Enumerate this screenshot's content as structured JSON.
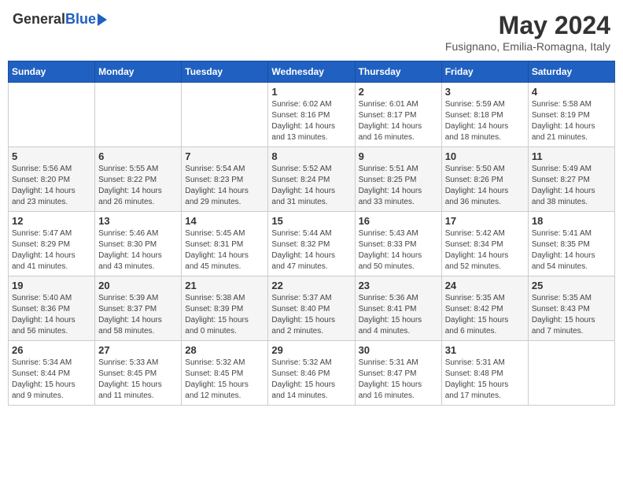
{
  "header": {
    "logo_general": "General",
    "logo_blue": "Blue",
    "month_title": "May 2024",
    "location": "Fusignano, Emilia-Romagna, Italy"
  },
  "weekdays": [
    "Sunday",
    "Monday",
    "Tuesday",
    "Wednesday",
    "Thursday",
    "Friday",
    "Saturday"
  ],
  "weeks": [
    [
      {
        "day": "",
        "info": ""
      },
      {
        "day": "",
        "info": ""
      },
      {
        "day": "",
        "info": ""
      },
      {
        "day": "1",
        "info": "Sunrise: 6:02 AM\nSunset: 8:16 PM\nDaylight: 14 hours\nand 13 minutes."
      },
      {
        "day": "2",
        "info": "Sunrise: 6:01 AM\nSunset: 8:17 PM\nDaylight: 14 hours\nand 16 minutes."
      },
      {
        "day": "3",
        "info": "Sunrise: 5:59 AM\nSunset: 8:18 PM\nDaylight: 14 hours\nand 18 minutes."
      },
      {
        "day": "4",
        "info": "Sunrise: 5:58 AM\nSunset: 8:19 PM\nDaylight: 14 hours\nand 21 minutes."
      }
    ],
    [
      {
        "day": "5",
        "info": "Sunrise: 5:56 AM\nSunset: 8:20 PM\nDaylight: 14 hours\nand 23 minutes."
      },
      {
        "day": "6",
        "info": "Sunrise: 5:55 AM\nSunset: 8:22 PM\nDaylight: 14 hours\nand 26 minutes."
      },
      {
        "day": "7",
        "info": "Sunrise: 5:54 AM\nSunset: 8:23 PM\nDaylight: 14 hours\nand 29 minutes."
      },
      {
        "day": "8",
        "info": "Sunrise: 5:52 AM\nSunset: 8:24 PM\nDaylight: 14 hours\nand 31 minutes."
      },
      {
        "day": "9",
        "info": "Sunrise: 5:51 AM\nSunset: 8:25 PM\nDaylight: 14 hours\nand 33 minutes."
      },
      {
        "day": "10",
        "info": "Sunrise: 5:50 AM\nSunset: 8:26 PM\nDaylight: 14 hours\nand 36 minutes."
      },
      {
        "day": "11",
        "info": "Sunrise: 5:49 AM\nSunset: 8:27 PM\nDaylight: 14 hours\nand 38 minutes."
      }
    ],
    [
      {
        "day": "12",
        "info": "Sunrise: 5:47 AM\nSunset: 8:29 PM\nDaylight: 14 hours\nand 41 minutes."
      },
      {
        "day": "13",
        "info": "Sunrise: 5:46 AM\nSunset: 8:30 PM\nDaylight: 14 hours\nand 43 minutes."
      },
      {
        "day": "14",
        "info": "Sunrise: 5:45 AM\nSunset: 8:31 PM\nDaylight: 14 hours\nand 45 minutes."
      },
      {
        "day": "15",
        "info": "Sunrise: 5:44 AM\nSunset: 8:32 PM\nDaylight: 14 hours\nand 47 minutes."
      },
      {
        "day": "16",
        "info": "Sunrise: 5:43 AM\nSunset: 8:33 PM\nDaylight: 14 hours\nand 50 minutes."
      },
      {
        "day": "17",
        "info": "Sunrise: 5:42 AM\nSunset: 8:34 PM\nDaylight: 14 hours\nand 52 minutes."
      },
      {
        "day": "18",
        "info": "Sunrise: 5:41 AM\nSunset: 8:35 PM\nDaylight: 14 hours\nand 54 minutes."
      }
    ],
    [
      {
        "day": "19",
        "info": "Sunrise: 5:40 AM\nSunset: 8:36 PM\nDaylight: 14 hours\nand 56 minutes."
      },
      {
        "day": "20",
        "info": "Sunrise: 5:39 AM\nSunset: 8:37 PM\nDaylight: 14 hours\nand 58 minutes."
      },
      {
        "day": "21",
        "info": "Sunrise: 5:38 AM\nSunset: 8:39 PM\nDaylight: 15 hours\nand 0 minutes."
      },
      {
        "day": "22",
        "info": "Sunrise: 5:37 AM\nSunset: 8:40 PM\nDaylight: 15 hours\nand 2 minutes."
      },
      {
        "day": "23",
        "info": "Sunrise: 5:36 AM\nSunset: 8:41 PM\nDaylight: 15 hours\nand 4 minutes."
      },
      {
        "day": "24",
        "info": "Sunrise: 5:35 AM\nSunset: 8:42 PM\nDaylight: 15 hours\nand 6 minutes."
      },
      {
        "day": "25",
        "info": "Sunrise: 5:35 AM\nSunset: 8:43 PM\nDaylight: 15 hours\nand 7 minutes."
      }
    ],
    [
      {
        "day": "26",
        "info": "Sunrise: 5:34 AM\nSunset: 8:44 PM\nDaylight: 15 hours\nand 9 minutes."
      },
      {
        "day": "27",
        "info": "Sunrise: 5:33 AM\nSunset: 8:45 PM\nDaylight: 15 hours\nand 11 minutes."
      },
      {
        "day": "28",
        "info": "Sunrise: 5:32 AM\nSunset: 8:45 PM\nDaylight: 15 hours\nand 12 minutes."
      },
      {
        "day": "29",
        "info": "Sunrise: 5:32 AM\nSunset: 8:46 PM\nDaylight: 15 hours\nand 14 minutes."
      },
      {
        "day": "30",
        "info": "Sunrise: 5:31 AM\nSunset: 8:47 PM\nDaylight: 15 hours\nand 16 minutes."
      },
      {
        "day": "31",
        "info": "Sunrise: 5:31 AM\nSunset: 8:48 PM\nDaylight: 15 hours\nand 17 minutes."
      },
      {
        "day": "",
        "info": ""
      }
    ]
  ]
}
